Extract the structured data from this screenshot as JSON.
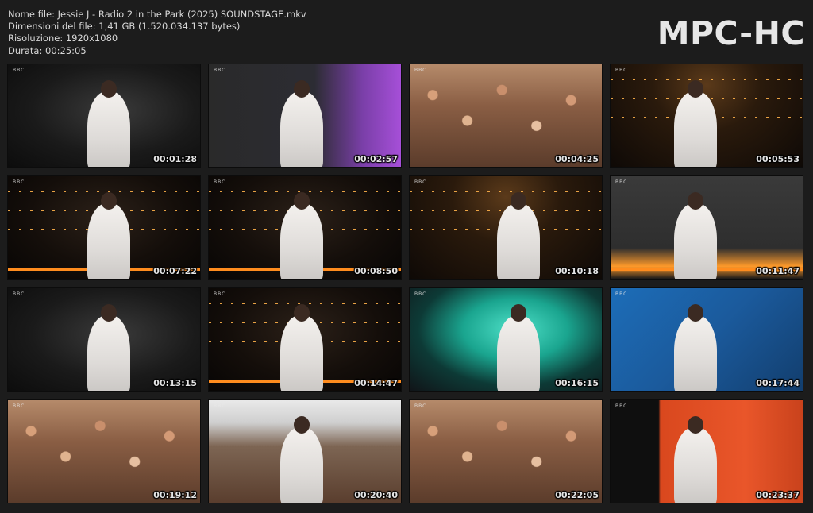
{
  "header": {
    "file_name": "Nome file: Jessie J - Radio 2 in the Park (2025) SOUNDSTAGE.mkv",
    "file_size": "Dimensioni del file: 1,41 GB (1.520.034.137 bytes)",
    "resolution": "Risoluzione: 1920x1080",
    "duration": "Durata: 00:25:05",
    "logo": "MPC-HC"
  },
  "thumbnails": [
    {
      "time": "00:01:28",
      "scene": "dark"
    },
    {
      "time": "00:02:57",
      "scene": "purple"
    },
    {
      "time": "00:04:25",
      "scene": "crowd"
    },
    {
      "time": "00:05:53",
      "scene": "stage"
    },
    {
      "time": "00:07:22",
      "scene": "stage2"
    },
    {
      "time": "00:08:50",
      "scene": "stage2"
    },
    {
      "time": "00:10:18",
      "scene": "stage"
    },
    {
      "time": "00:11:47",
      "scene": "grey"
    },
    {
      "time": "00:13:15",
      "scene": "dark"
    },
    {
      "time": "00:14:47",
      "scene": "stage2"
    },
    {
      "time": "00:16:15",
      "scene": "teal"
    },
    {
      "time": "00:17:44",
      "scene": "blue"
    },
    {
      "time": "00:19:12",
      "scene": "crowd"
    },
    {
      "time": "00:20:40",
      "scene": "sky"
    },
    {
      "time": "00:22:05",
      "scene": "crowd"
    },
    {
      "time": "00:23:37",
      "scene": "orange"
    }
  ],
  "watermark": "BBC"
}
